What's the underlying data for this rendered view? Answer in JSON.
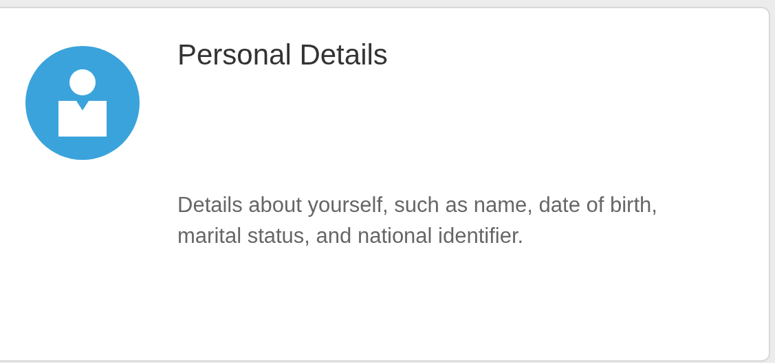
{
  "card": {
    "title": "Personal Details",
    "description": "Details about yourself, such as name, date of birth, marital status, and national identifier."
  }
}
